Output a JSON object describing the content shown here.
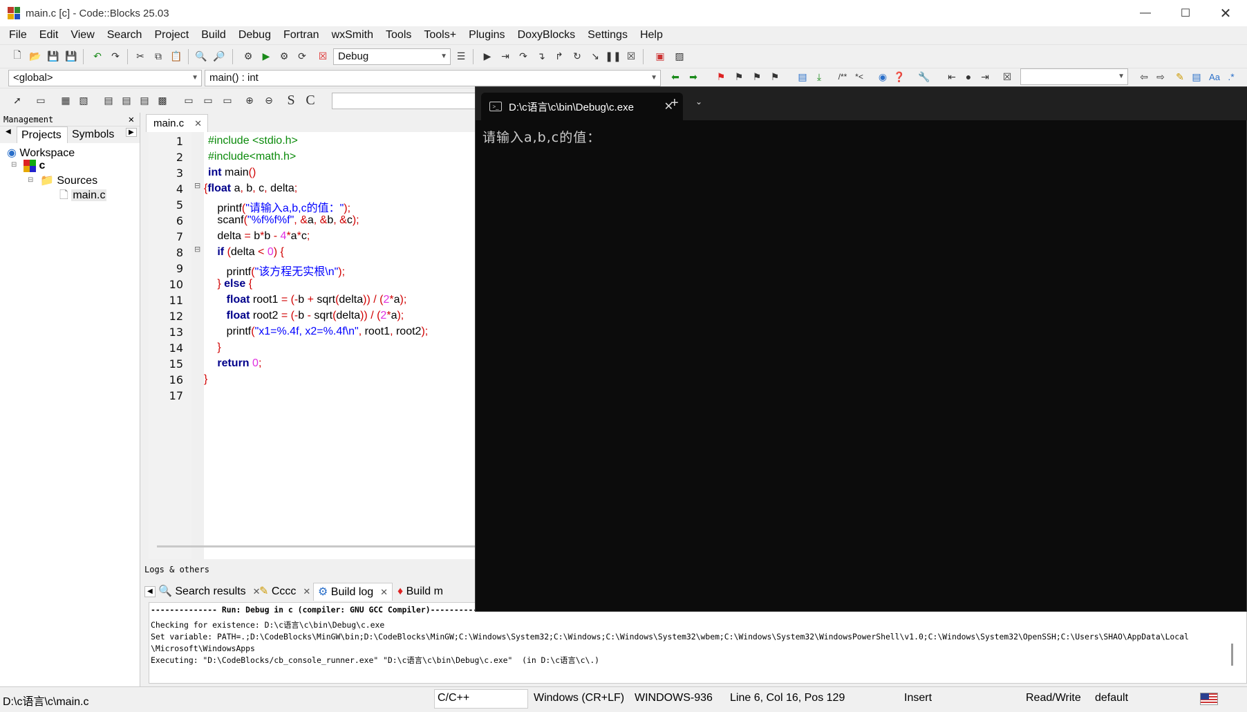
{
  "window": {
    "title": "main.c [c] - Code::Blocks 25.03"
  },
  "menu": [
    "File",
    "Edit",
    "View",
    "Search",
    "Project",
    "Build",
    "Debug",
    "Fortran",
    "wxSmith",
    "Tools",
    "Tools+",
    "Plugins",
    "DoxyBlocks",
    "Settings",
    "Help"
  ],
  "toolbar": {
    "build_target": "Debug",
    "scope": "<global>",
    "function": "main() : int"
  },
  "management": {
    "title": "Management",
    "tabs": [
      "Projects",
      "Symbols"
    ],
    "tree": {
      "workspace": "Workspace",
      "project": "c",
      "folder": "Sources",
      "file": "main.c"
    }
  },
  "editor": {
    "tab": "main.c",
    "lines": [
      "1",
      "2",
      "3",
      "4",
      "5",
      "6",
      "7",
      "8",
      "9",
      "10",
      "11",
      "12",
      "13",
      "14",
      "15",
      "16",
      "17"
    ]
  },
  "logs": {
    "title": "Logs & others",
    "tabs": [
      "Search results",
      "Cccc",
      "Build log",
      "Build m"
    ],
    "lines": [
      "-------------- Run: Debug in c (compiler: GNU GCC Compiler)---------------",
      "Checking for existence: D:\\c语言\\c\\bin\\Debug\\c.exe",
      "Set variable: PATH=.;D:\\CodeBlocks\\MinGW\\bin;D:\\CodeBlocks\\MinGW;C:\\Windows\\System32;C:\\Windows;C:\\Windows\\System32\\wbem;C:\\Windows\\System32\\WindowsPowerShell\\v1.0;C:\\Windows\\System32\\OpenSSH;C:\\Users\\SHAO\\AppData\\Local",
      "\\Microsoft\\WindowsApps",
      "Executing: \"D:\\CodeBlocks/cb_console_runner.exe\" \"D:\\c语言\\c\\bin\\Debug\\c.exe\"  (in D:\\c语言\\c\\.)"
    ]
  },
  "status": {
    "path": "D:\\c语言\\c\\main.c",
    "lang": "C/C++",
    "eol": "Windows (CR+LF)",
    "encoding": "WINDOWS-936",
    "position": "Line 6, Col 16, Pos 129",
    "mode": "Insert",
    "access": "Read/Write",
    "theme": "default"
  },
  "terminal": {
    "tab_title": "D:\\c语言\\c\\bin\\Debug\\c.exe",
    "output": "请输入a,b,c的值："
  },
  "colors": {
    "terminal_bg": "#0c0c0c",
    "change_bar": "#4cd04c",
    "keyword": "#00008b"
  }
}
